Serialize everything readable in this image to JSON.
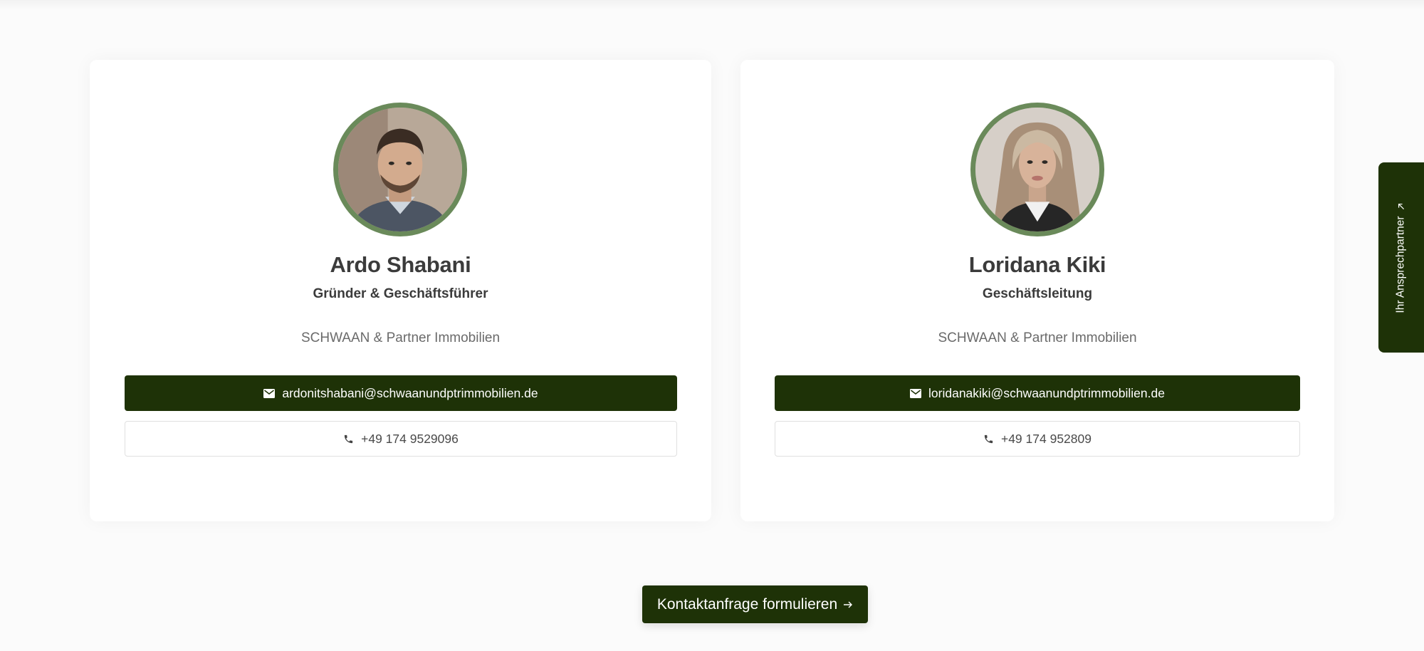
{
  "contacts": [
    {
      "name": "Ardo Shabani",
      "role": "Gründer & Geschäftsführer",
      "company": "SCHWAAN & Partner Immobilien",
      "email": "ardonitshabani@schwaanundptrimmobilien.de",
      "phone": "+49 174 9529096"
    },
    {
      "name": "Loridana Kiki",
      "role": "Geschäftsleitung",
      "company": "SCHWAAN & Partner Immobilien",
      "email": "loridanakiki@schwaanundptrimmobilien.de",
      "phone": "+49 174 952809"
    }
  ],
  "cta": {
    "label": "Kontaktanfrage formulieren",
    "icon": "arrow-right-icon"
  },
  "side_tab": {
    "label": "Ihr Ansprechpartner",
    "icon": "arrow-up-right-icon"
  },
  "icons": {
    "email": "mail-icon",
    "phone": "phone-icon"
  },
  "colors": {
    "primary": "#1e3207",
    "avatar_ring": "#6a8a5a",
    "background": "#fbfbfb",
    "card": "#ffffff"
  }
}
